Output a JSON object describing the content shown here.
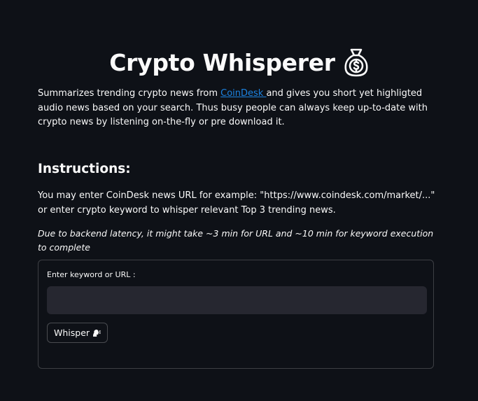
{
  "header": {
    "title": "Crypto Whisperer",
    "title_icon": "moneybag-icon"
  },
  "intro": {
    "text_before_link": "Summarizes trending crypto news from ",
    "link_label": "CoinDesk ",
    "text_after_link": "and gives you short yet highligted audio news based on your search. Thus busy people can always keep up-to-date with crypto news by listening on-the-fly or pre download it."
  },
  "instructions": {
    "heading": "Instructions:",
    "body": "You may enter CoinDesk news URL for example: \"https://www.coindesk.com/market/...\" or enter crypto keyword to whisper relevant Top 3 trending news.",
    "latency_note": "Due to backend latency, it might take ~3 min for URL and ~10 min for keyword execution to complete"
  },
  "form": {
    "input_label": "Enter keyword or URL :",
    "input_value": "",
    "button_label": "Whisper",
    "button_icon": "speaking-head-icon"
  },
  "colors": {
    "background": "#0e1117",
    "text": "#fafafa",
    "link": "#1c83e1",
    "input_background": "#262730"
  }
}
